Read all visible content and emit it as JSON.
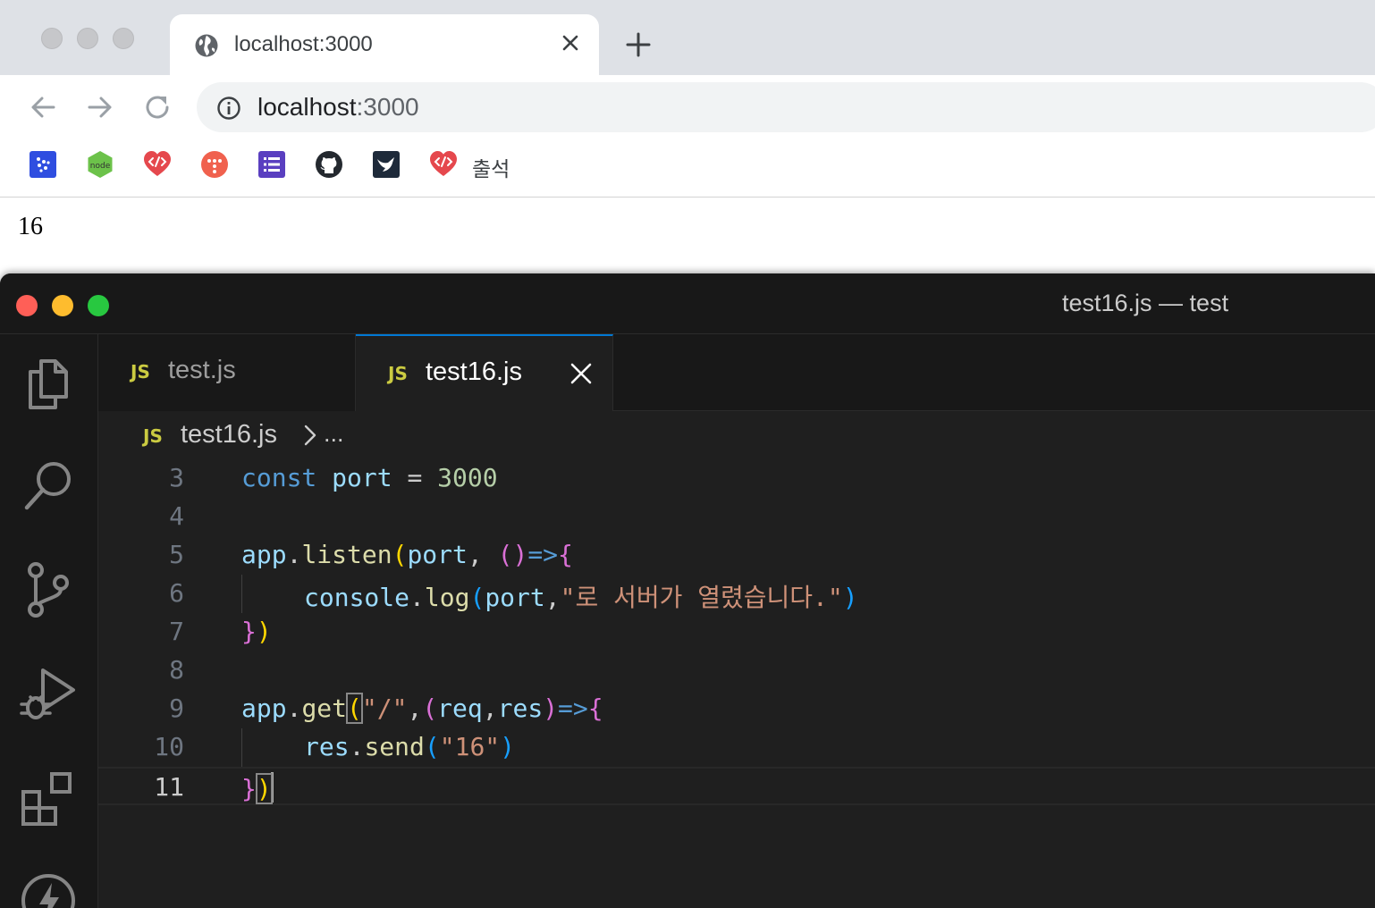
{
  "browser": {
    "tab": {
      "title": "localhost:3000"
    },
    "address": {
      "host": "localhost",
      "port": ":3000"
    },
    "bookmarks": {
      "items": [
        {
          "icon": "blue-grid-icon",
          "color": "#2f4ee0"
        },
        {
          "icon": "nodejs-icon",
          "color": "#6cc24a"
        },
        {
          "icon": "code-heart-icon",
          "color": "#e5484d"
        },
        {
          "icon": "orange-circle-icon",
          "color": "#f0614e"
        },
        {
          "icon": "list-icon",
          "color": "#5a3fc0"
        },
        {
          "icon": "github-icon",
          "color": "#24292f"
        },
        {
          "icon": "bird-icon",
          "color": "#1e2a3a"
        },
        {
          "icon": "code-heart-icon",
          "color": "#e5484d"
        }
      ],
      "last_label": "출석"
    },
    "page": {
      "text": "16"
    }
  },
  "vscode": {
    "title": "test16.js — test",
    "tabs": [
      {
        "badge": "JS",
        "name": "test.js",
        "active": false
      },
      {
        "badge": "JS",
        "name": "test16.js",
        "active": true
      }
    ],
    "breadcrumb": {
      "badge": "JS",
      "file": "test16.js",
      "more": "..."
    },
    "line_numbers": [
      "3",
      "4",
      "5",
      "6",
      "7",
      "8",
      "9",
      "10",
      "11"
    ],
    "code": {
      "l3": {
        "t1": "const",
        "t2": "port",
        "t3": "=",
        "t4": "3000"
      },
      "l5": {
        "t1": "app",
        "t2": ".",
        "t3": "listen",
        "t4": "(",
        "t5": "port",
        "t6": ",",
        "t7": "()",
        "t8": "=>",
        "t9": "{"
      },
      "l6": {
        "t1": "console",
        "t2": ".",
        "t3": "log",
        "t4": "(",
        "t5": "port",
        "t6": ",",
        "t7": "\"로 서버가 열렸습니다.\"",
        "t8": ")"
      },
      "l7": {
        "t1": "}",
        "t2": ")"
      },
      "l9": {
        "t1": "app",
        "t2": ".",
        "t3": "get",
        "t4": "(",
        "t5": "\"/\"",
        "t6": ",",
        "t7": "(",
        "t8": "req",
        "t9": ",",
        "t10": "res",
        "t11": ")",
        "t12": "=>",
        "t13": "{"
      },
      "l10": {
        "t1": "res",
        "t2": ".",
        "t3": "send",
        "t4": "(",
        "t5": "\"16\"",
        "t6": ")"
      },
      "l11": {
        "t1": "}",
        "t2": ")"
      }
    },
    "colors": {
      "accent": "#0078d4",
      "close": "#ff5f57",
      "minimize": "#febc2e",
      "maximize": "#28c840"
    }
  }
}
